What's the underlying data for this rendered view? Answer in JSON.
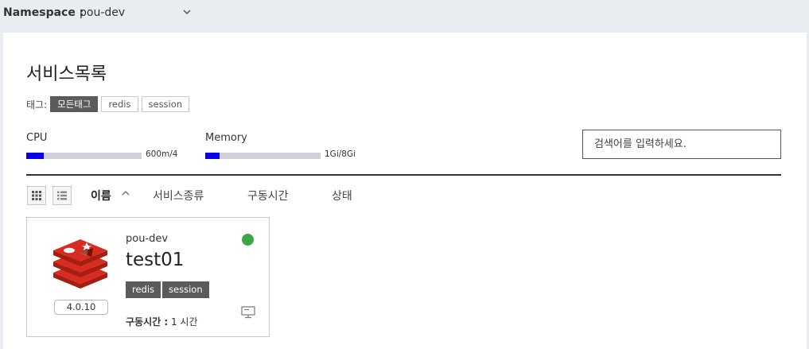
{
  "namespace": {
    "label": "Namespace :",
    "selected": "pou-dev"
  },
  "page": {
    "title": "서비스목록"
  },
  "tags": {
    "prefix": "태그:",
    "items": [
      {
        "label": "모든태그",
        "active": true
      },
      {
        "label": "redis",
        "active": false
      },
      {
        "label": "session",
        "active": false
      }
    ]
  },
  "usage": {
    "cpu": {
      "title": "CPU",
      "value": "600m/4",
      "fraction": 0.15
    },
    "memory": {
      "title": "Memory",
      "value": "1Gi/8Gi",
      "fraction": 0.125
    }
  },
  "search": {
    "placeholder": "검색어를 입력하세요."
  },
  "sort": {
    "items": [
      "이름",
      "서비스종류",
      "구동시간",
      "상태"
    ],
    "active": "이름",
    "direction": "ascending"
  },
  "cards": [
    {
      "namespace": "pou-dev",
      "name": "test01",
      "version": "4.0.10",
      "tags": [
        "redis",
        "session"
      ],
      "uptime_label": "구동시간 :",
      "uptime_value": "1 시간",
      "status": "running",
      "status_color": "#3ea545",
      "icon": "redis-logo"
    }
  ],
  "colors": {
    "usage_fill": "#0a00e8",
    "tag_active": "#5b5b5b"
  }
}
